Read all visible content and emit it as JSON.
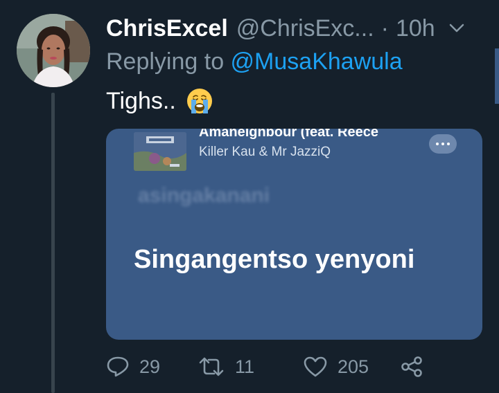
{
  "tweet": {
    "display_name": "ChrisExcel",
    "handle": "@ChrisExc...",
    "separator": "·",
    "time": "10h",
    "replying_prefix": "Replying to ",
    "replying_to": "@MusaKhawula",
    "text": "Tighs..",
    "emoji": "loudly-crying-face"
  },
  "media": {
    "song_title": "Amaneighbour (feat. Reece",
    "artists": "Killer Kau & Mr JazziQ",
    "faded_lyric": "asingakanani",
    "lyric": "Singangentso yenyoni"
  },
  "actions": {
    "reply_count": "29",
    "retweet_count": "11",
    "like_count": "205"
  },
  "colors": {
    "background": "#15202b",
    "card": "#3a5a86",
    "mention": "#1da1f2",
    "muted": "#8899a6"
  },
  "icons": [
    "chevron-down-icon",
    "reply-icon",
    "retweet-icon",
    "heart-icon",
    "share-icon",
    "more-icon"
  ]
}
